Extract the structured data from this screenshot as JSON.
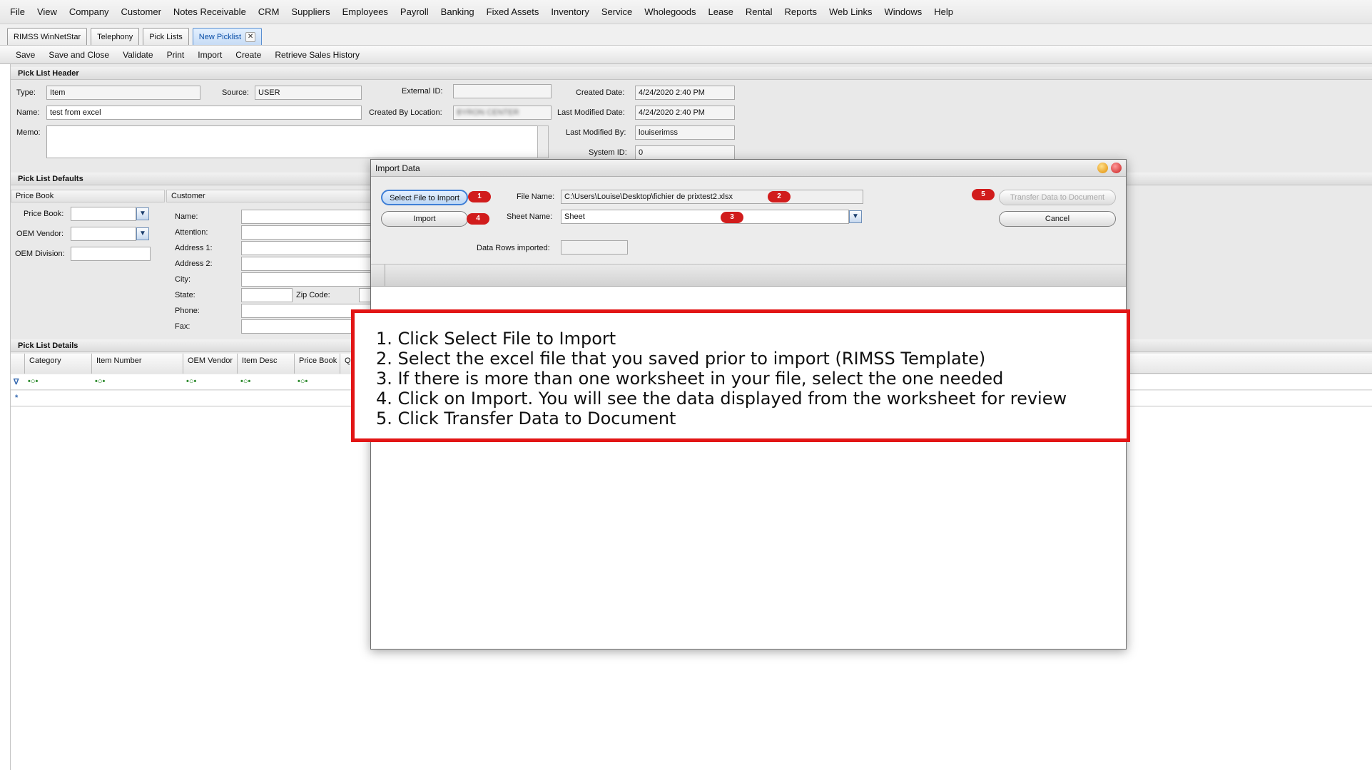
{
  "menu": [
    "File",
    "View",
    "Company",
    "Customer",
    "Notes Receivable",
    "CRM",
    "Suppliers",
    "Employees",
    "Payroll",
    "Banking",
    "Fixed Assets",
    "Inventory",
    "Service",
    "Wholegoods",
    "Lease",
    "Rental",
    "Reports",
    "Web Links",
    "Windows",
    "Help"
  ],
  "tabs": [
    {
      "label": "RIMSS WinNetStar"
    },
    {
      "label": "Telephony"
    },
    {
      "label": "Pick Lists"
    },
    {
      "label": "New Picklist",
      "active": true
    }
  ],
  "tab_close": "✕",
  "toolbar": [
    "Save",
    "Save and Close",
    "Validate",
    "Print",
    "Import",
    "Create",
    "Retrieve Sales History"
  ],
  "header": {
    "title": "Pick List Header",
    "type_label": "Type:",
    "type_value": "Item",
    "source_label": "Source:",
    "source_value": "USER",
    "external_id_label": "External ID:",
    "external_id_value": "",
    "created_date_label": "Created Date:",
    "created_date_value": "4/24/2020 2:40 PM",
    "name_label": "Name:",
    "name_value": "test from excel",
    "created_by_location_label": "Created By Location:",
    "created_by_location_value": "BYRON CENTER",
    "last_modified_date_label": "Last Modified Date:",
    "last_modified_date_value": "4/24/2020 2:40 PM",
    "memo_label": "Memo:",
    "last_modified_by_label": "Last Modified By:",
    "last_modified_by_value": "louiserimss",
    "system_id_label": "System ID:",
    "system_id_value": "0"
  },
  "defaults": {
    "title": "Pick List Defaults",
    "price_book_section": "Price Book",
    "customer_section": "Customer",
    "price_book_label": "Price Book:",
    "oem_vendor_label": "OEM Vendor:",
    "oem_division_label": "OEM Division:",
    "name_label": "Name:",
    "attention_label": "Attention:",
    "address1_label": "Address 1:",
    "address2_label": "Address 2:",
    "city_label": "City:",
    "state_label": "State:",
    "zip_label": "Zip Code:",
    "phone_label": "Phone:",
    "fax_label": "Fax:"
  },
  "details": {
    "title": "Pick List Details",
    "columns": [
      "Category",
      "Item Number",
      "OEM Vendor",
      "Item Desc",
      "Price Book",
      "Q"
    ],
    "filter_icon": "∇",
    "new_row_icon": "*"
  },
  "dialog": {
    "title": "Import Data",
    "select_file_button": "Select File to Import",
    "import_button": "Import",
    "file_name_label": "File Name:",
    "file_name_value": "C:\\Users\\Louise\\Desktop\\fichier de prixtest2.xlsx",
    "sheet_name_label": "Sheet Name:",
    "sheet_name_value": "Sheet",
    "data_rows_label": "Data Rows imported:",
    "data_rows_value": "",
    "transfer_button": "Transfer Data to Document",
    "cancel_button": "Cancel",
    "badges": [
      "1",
      "2",
      "3",
      "4",
      "5"
    ]
  },
  "instructions": [
    "1. Click Select File to Import",
    "2. Select the excel file that you saved prior to import (RIMSS Template)",
    "3. If there is more than one worksheet in your file, select the one needed",
    "4. Click on Import. You will see the data displayed from the worksheet for review",
    "5. Click Transfer Data to Document"
  ],
  "colors": {
    "callout_border": "#e21515",
    "badge": "#d11c1c",
    "selected_button": "#3f7fd6"
  }
}
